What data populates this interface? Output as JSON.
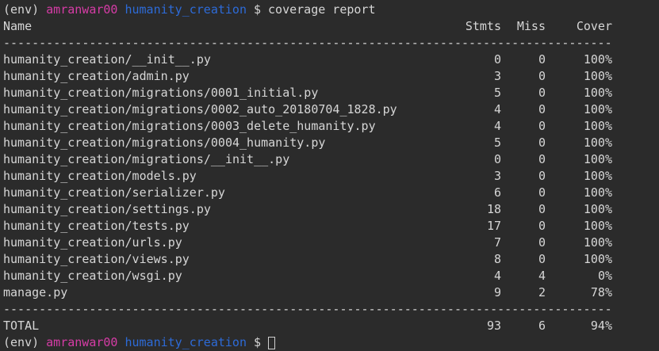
{
  "colors": {
    "background": "#2b2b2b",
    "foreground": "#d6d6d6",
    "prompt_user_magenta": "#d63ca6",
    "prompt_dir_blue": "#2d6bd8"
  },
  "terminal": {
    "prompt": {
      "env": "(env)",
      "user": "amranwar00",
      "dir": "humanity_creation",
      "dollar": "$",
      "command": "coverage report"
    },
    "header": {
      "name": "Name",
      "stmts": "Stmts",
      "miss": "Miss",
      "cover": "Cover"
    },
    "separator": "-------------------------------------------------------------------------------------",
    "rows": [
      {
        "name": "humanity_creation/__init__.py",
        "stmts": "0",
        "miss": "0",
        "cover": "100%"
      },
      {
        "name": "humanity_creation/admin.py",
        "stmts": "3",
        "miss": "0",
        "cover": "100%"
      },
      {
        "name": "humanity_creation/migrations/0001_initial.py",
        "stmts": "5",
        "miss": "0",
        "cover": "100%"
      },
      {
        "name": "humanity_creation/migrations/0002_auto_20180704_1828.py",
        "stmts": "4",
        "miss": "0",
        "cover": "100%"
      },
      {
        "name": "humanity_creation/migrations/0003_delete_humanity.py",
        "stmts": "4",
        "miss": "0",
        "cover": "100%"
      },
      {
        "name": "humanity_creation/migrations/0004_humanity.py",
        "stmts": "5",
        "miss": "0",
        "cover": "100%"
      },
      {
        "name": "humanity_creation/migrations/__init__.py",
        "stmts": "0",
        "miss": "0",
        "cover": "100%"
      },
      {
        "name": "humanity_creation/models.py",
        "stmts": "3",
        "miss": "0",
        "cover": "100%"
      },
      {
        "name": "humanity_creation/serializer.py",
        "stmts": "6",
        "miss": "0",
        "cover": "100%"
      },
      {
        "name": "humanity_creation/settings.py",
        "stmts": "18",
        "miss": "0",
        "cover": "100%"
      },
      {
        "name": "humanity_creation/tests.py",
        "stmts": "17",
        "miss": "0",
        "cover": "100%"
      },
      {
        "name": "humanity_creation/urls.py",
        "stmts": "7",
        "miss": "0",
        "cover": "100%"
      },
      {
        "name": "humanity_creation/views.py",
        "stmts": "8",
        "miss": "0",
        "cover": "100%"
      },
      {
        "name": "humanity_creation/wsgi.py",
        "stmts": "4",
        "miss": "4",
        "cover": "0%"
      },
      {
        "name": "manage.py",
        "stmts": "9",
        "miss": "2",
        "cover": "78%"
      }
    ],
    "total": {
      "name": "TOTAL",
      "stmts": "93",
      "miss": "6",
      "cover": "94%"
    },
    "bottom_prompt": {
      "env": "(env)",
      "user": "amranwar00",
      "dir": "humanity_creation",
      "dollar": "$"
    }
  }
}
